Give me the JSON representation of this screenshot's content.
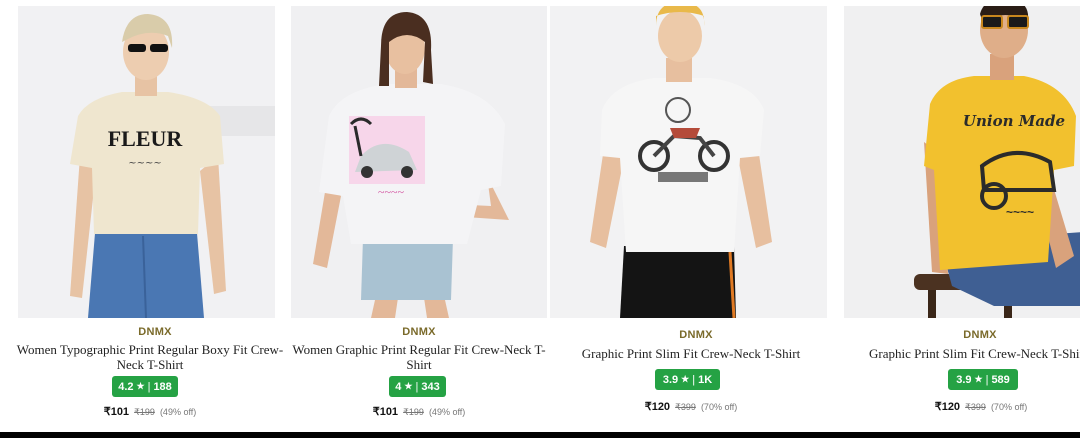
{
  "products": [
    {
      "brand": "DNMX",
      "title": "Women Typographic Print Regular Boxy Fit Crew-Neck T-Shirt",
      "rating": "4.2",
      "reviews": "188",
      "price": "₹101",
      "mrp": "₹199",
      "discount": "(49% off)",
      "shirt_print_text": "FLEUR",
      "shirt_color": "#efe6cf"
    },
    {
      "brand": "DNMX",
      "title": "Women Graphic Print Regular Fit Crew-Neck T-Shirt",
      "rating": "4",
      "reviews": "343",
      "price": "₹101",
      "mrp": "₹199",
      "discount": "(49% off)",
      "shirt_color": "#f4f4f6"
    },
    {
      "brand": "DNMX",
      "title": "Graphic Print Slim Fit Crew-Neck T-Shirt",
      "rating": "3.9",
      "reviews": "1K",
      "price": "₹120",
      "mrp": "₹399",
      "discount": "(70% off)",
      "shirt_color": "#f6f6f6"
    },
    {
      "brand": "DNMX",
      "title": "Graphic Print Slim Fit Crew-Neck T-Shirt",
      "rating": "3.9",
      "reviews": "589",
      "price": "₹120",
      "mrp": "₹399",
      "discount": "(70% off)",
      "shirt_print_text": "Union Made",
      "shirt_color": "#f2c12e"
    }
  ],
  "colors": {
    "rating_badge": "#25a244",
    "brand_text": "#7a6a2a"
  },
  "icons": {
    "rating": "star-icon"
  }
}
